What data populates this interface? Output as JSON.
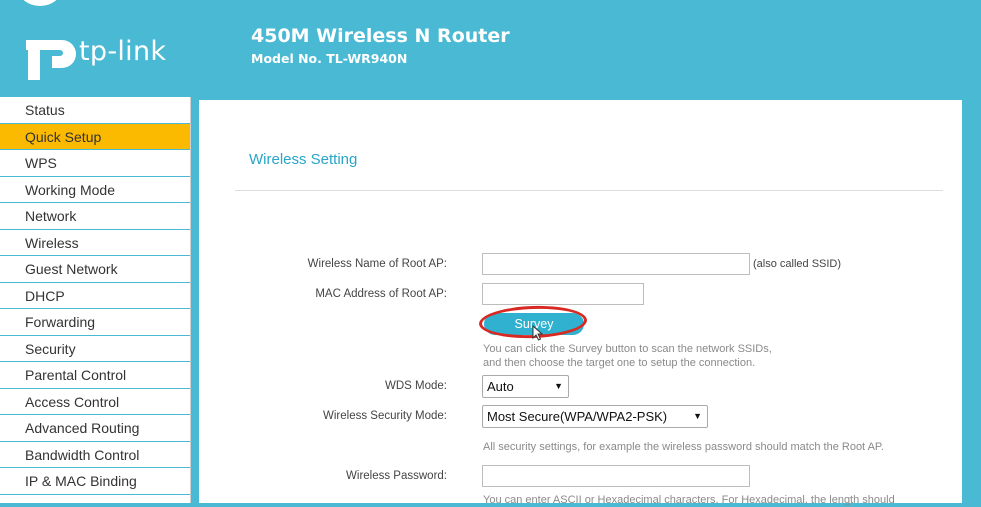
{
  "header": {
    "brand": "tp-link",
    "product_title": "450M Wireless N Router",
    "model_no": "Model No. TL-WR940N"
  },
  "sidebar": {
    "items": [
      {
        "label": "Status"
      },
      {
        "label": "Quick Setup"
      },
      {
        "label": "WPS"
      },
      {
        "label": "Working Mode"
      },
      {
        "label": "Network"
      },
      {
        "label": "Wireless"
      },
      {
        "label": "Guest Network"
      },
      {
        "label": "DHCP"
      },
      {
        "label": "Forwarding"
      },
      {
        "label": "Security"
      },
      {
        "label": "Parental Control"
      },
      {
        "label": "Access Control"
      },
      {
        "label": "Advanced Routing"
      },
      {
        "label": "Bandwidth Control"
      },
      {
        "label": "IP & MAC Binding"
      }
    ],
    "active_item": "Quick Setup"
  },
  "main": {
    "section_title": "Wireless Setting",
    "ssid": {
      "label": "Wireless Name of Root AP:",
      "value": "",
      "note": "(also called SSID)"
    },
    "mac": {
      "label": "MAC Address of Root AP:",
      "value": ""
    },
    "survey": {
      "button_label": "Survey",
      "help_line1": "You can click the Survey button to scan the network SSIDs,",
      "help_line2": "and then choose the target one to setup the connection."
    },
    "wds_mode": {
      "label": "WDS Mode:",
      "selected": "Auto"
    },
    "security_mode": {
      "label": "Wireless Security Mode:",
      "selected": "Most Secure(WPA/WPA2-PSK)",
      "help": "All security settings, for example the wireless password should match the Root AP."
    },
    "password": {
      "label": "Wireless Password:",
      "value": "",
      "help": "You can enter ASCII or Hexadecimal characters. For Hexadecimal, the length should"
    }
  },
  "colors": {
    "header_bg": "#4ab9d4",
    "active_item": "#fbba00",
    "section_title": "#29a5c8",
    "survey_button": "#2fb1cf",
    "annotation_circle": "#d82a22"
  }
}
